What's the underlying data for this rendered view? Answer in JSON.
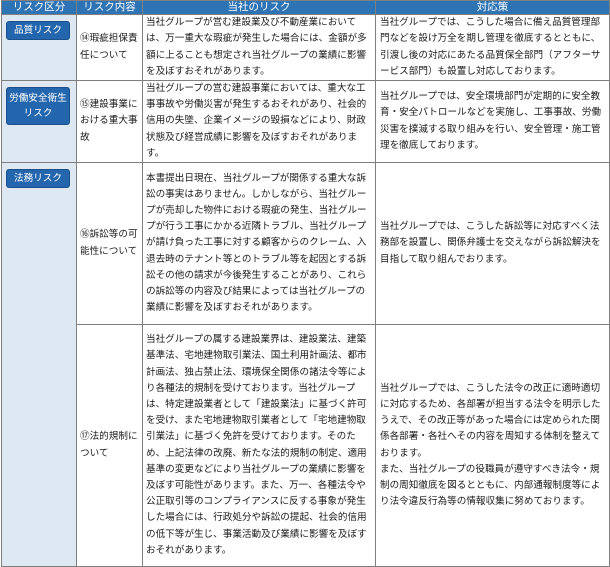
{
  "headers": [
    "リスク区分",
    "リスク内容",
    "当社のリスク",
    "対応策"
  ],
  "rows": [
    {
      "category": "品質リスク",
      "item": "⑭瑕疵担保責任について",
      "risk": "当社グループが営む建設業及び不動産業においては、万一重大な瑕疵が発生した場合には、金額が多額に上ることも想定され当社グループの業績に影響を及ぼすおそれがあります。",
      "measure": "当社グループでは、こうした場合に備え品質管理部門などを設け万全を期し管理を徹底するとともに、引渡し後の対応にあたる品質保全部門（アフターサービス部門）も設置し対応しております。"
    },
    {
      "category": "労働安全衛生リスク",
      "item": "⑮建設事業における重大事故",
      "risk": "当社グループの営む建設事業においては、重大な工事事故や労働災害が発生するおそれがあり、社会的信用の失墜、企業イメージの毀損などにより、財政状態及び経営成績に影響を及ぼすおそれがあります。",
      "measure": "当社グループでは、安全環境部門が定期的に安全教育・安全パトロールなどを実施し、工事事故、労働災害を撲滅する取り組みを行い、安全管理・施工管理を徹底しております。"
    },
    {
      "category": "法務リスク",
      "item": "⑯訴訟等の可能性について",
      "risk": "本書提出日現在、当社グループが関係する重大な訴訟の事実はありません。しかしながら、当社グループが売却した物件における瑕疵の発生、当社グループが行う工事にかかる近隣トラブル、当社グループが請け負った工事に対する顧客からのクレーム、入退去時のテナント等とのトラブル等を起因とする訴訟その他の請求が今後発生することがあり、これらの訴訟等の内容及び結果によっては当社グループの業績に影響を及ぼすおそれがあります。",
      "measure": "当社グループでは、こうした訴訟等に対応すべく法務部を設置し、関係弁護士を交えながら訴訟解決を目指して取り組んでおります。"
    },
    {
      "category": "",
      "item": "⑰法的規制について",
      "risk": "当社グループの属する建設業界は、建設業法、建築基準法、宅地建物取引業法、国土利用計画法、都市計画法、独占禁止法、環境保全関係の諸法令等により各種法的規制を受けております。当社グループは、特定建設業者として「建設業法」に基づく許可を受け、また宅地建物取引業者として「宅地建物取引業法」に基づく免許を受けております。そのため、上記法律の改廃、新たな法的規制の制定、適用基準の変更などにより当社グループの業績に影響を及ぼす可能性があります。また、万一、各種法令や公正取引等のコンプライアンスに反する事象が発生した場合には、行政処分や訴訟の提起、社会的信用の低下等が生じ、事業活動及び業績に影響を及ぼすおそれがあります。",
      "measure_1": "当社グループでは、こうした法令の改正に適時適切に対応するため、各部署が担当する法令を明示したうえで、その改正等があった場合には定められた関係各部署・各社へその内容を周知する体制を整えております。",
      "measure_2": "また、当社グループの役職員が遵守すべき法令・規制の周知徹底を図るとともに、内部通報制度等により法令違反行為等の情報収集に努めております。"
    }
  ]
}
